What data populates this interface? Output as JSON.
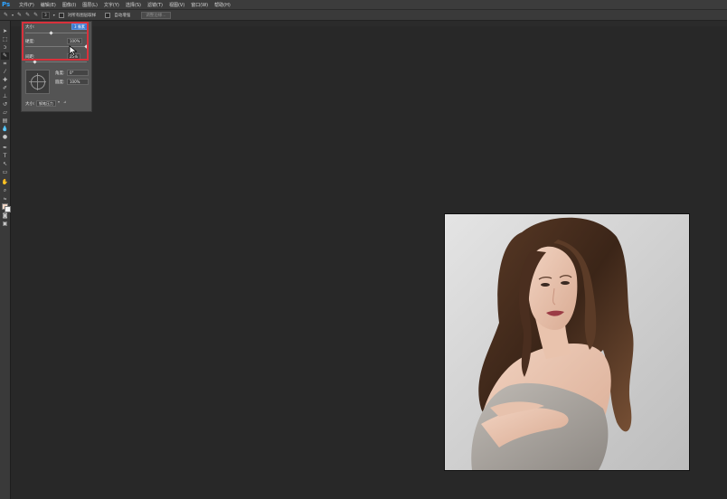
{
  "app": {
    "logo": "Ps",
    "accent_color": "#2fa3ff"
  },
  "menu": [
    "文件(F)",
    "编辑(E)",
    "图像(I)",
    "图层(L)",
    "文字(Y)",
    "选择(S)",
    "滤镜(T)",
    "视图(V)",
    "窗口(W)",
    "帮助(H)"
  ],
  "options_bar": {
    "brush_size": "3",
    "checkbox1_label": "对所有图层取样",
    "checkbox2_label": "自动增强",
    "button_label": "调整边缘..."
  },
  "brush_panel": {
    "size_label": "大小:",
    "size_value": "3 像素",
    "hardness_label": "硬度:",
    "hardness_value": "100%",
    "spacing_label": "间距:",
    "spacing_value": "25%",
    "angle_label": "角度:",
    "angle_value": "0°",
    "roundness_label": "圆度:",
    "roundness_value": "100%",
    "size_mode_label": "大小:",
    "size_mode_value": "钢笔压力"
  },
  "highlight_color": "#d9313b",
  "canvas": {
    "background": "#282828"
  }
}
